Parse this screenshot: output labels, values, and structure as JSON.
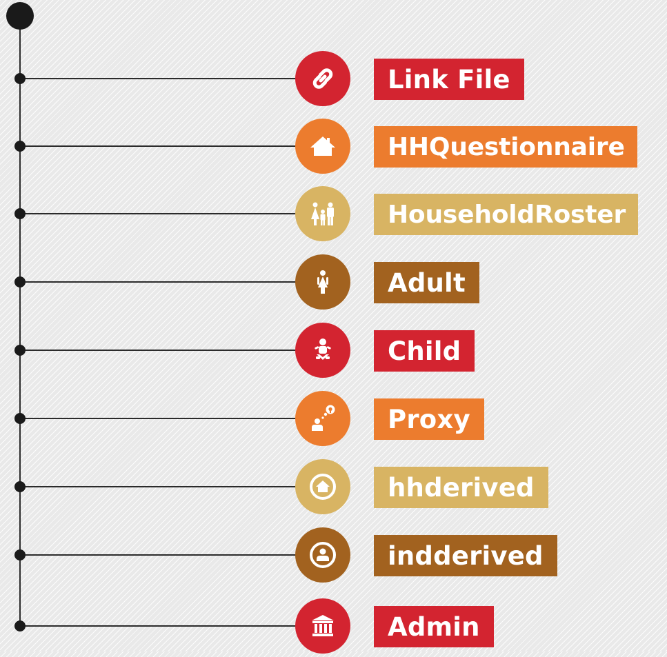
{
  "colors": {
    "red": "#d32430",
    "orange": "#ec7c2e",
    "tan": "#d8b463",
    "brown": "#a2621f",
    "line": "#2b2b2b"
  },
  "items": [
    {
      "label": "Link File",
      "color": "#d32430",
      "icon": "link-icon"
    },
    {
      "label": "HHQuestionnaire",
      "color": "#ec7c2e",
      "icon": "house-icon"
    },
    {
      "label": "HouseholdRoster",
      "color": "#d8b463",
      "icon": "family-icon"
    },
    {
      "label": "Adult",
      "color": "#a2621f",
      "icon": "person-icon"
    },
    {
      "label": "Child",
      "color": "#d32430",
      "icon": "baby-icon"
    },
    {
      "label": "Proxy",
      "color": "#ec7c2e",
      "icon": "proxy-person-icon"
    },
    {
      "label": "hhderived",
      "color": "#d8b463",
      "icon": "house-badge-icon"
    },
    {
      "label": "indderived",
      "color": "#a2621f",
      "icon": "person-badge-icon"
    },
    {
      "label": "Admin",
      "color": "#d32430",
      "icon": "building-icon"
    }
  ]
}
